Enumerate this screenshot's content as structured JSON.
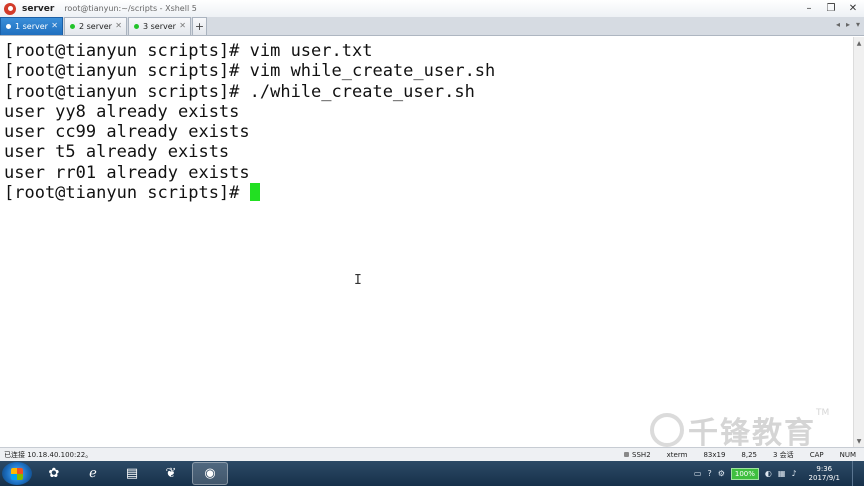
{
  "window": {
    "app_name": "server",
    "title": "root@tianyun:~/scripts - Xshell 5",
    "controls": {
      "minimize": "–",
      "restore": "❐",
      "close": "✕"
    }
  },
  "tabs": [
    {
      "label": "1 server",
      "active": true
    },
    {
      "label": "2 server",
      "active": false
    },
    {
      "label": "3 server",
      "active": false
    }
  ],
  "tab_add_label": "+",
  "tab_nav": {
    "prev": "◂",
    "next": "▸",
    "menu": "▾"
  },
  "terminal": {
    "lines": [
      "[root@tianyun scripts]# vim user.txt",
      "[root@tianyun scripts]# vim while_create_user.sh",
      "[root@tianyun scripts]# ./while_create_user.sh",
      "user yy8 already exists",
      "user cc99 already exists",
      "user t5 already exists",
      "user rr01 already exists",
      "[root@tianyun scripts]# "
    ],
    "cursor_color": "#22e022"
  },
  "watermark": {
    "text": "千锋教育",
    "tm": "TM"
  },
  "statusbar": {
    "connection": "已连接 10.18.40.100:22。",
    "protocol": "SSH2",
    "term": "xterm",
    "size": "83x19",
    "position": "8,25",
    "sessions": "3 会话",
    "caps": "CAP",
    "num": "NUM"
  },
  "taskbar": {
    "battery": "100%",
    "time": "9:36",
    "date": "2017/9/1"
  }
}
